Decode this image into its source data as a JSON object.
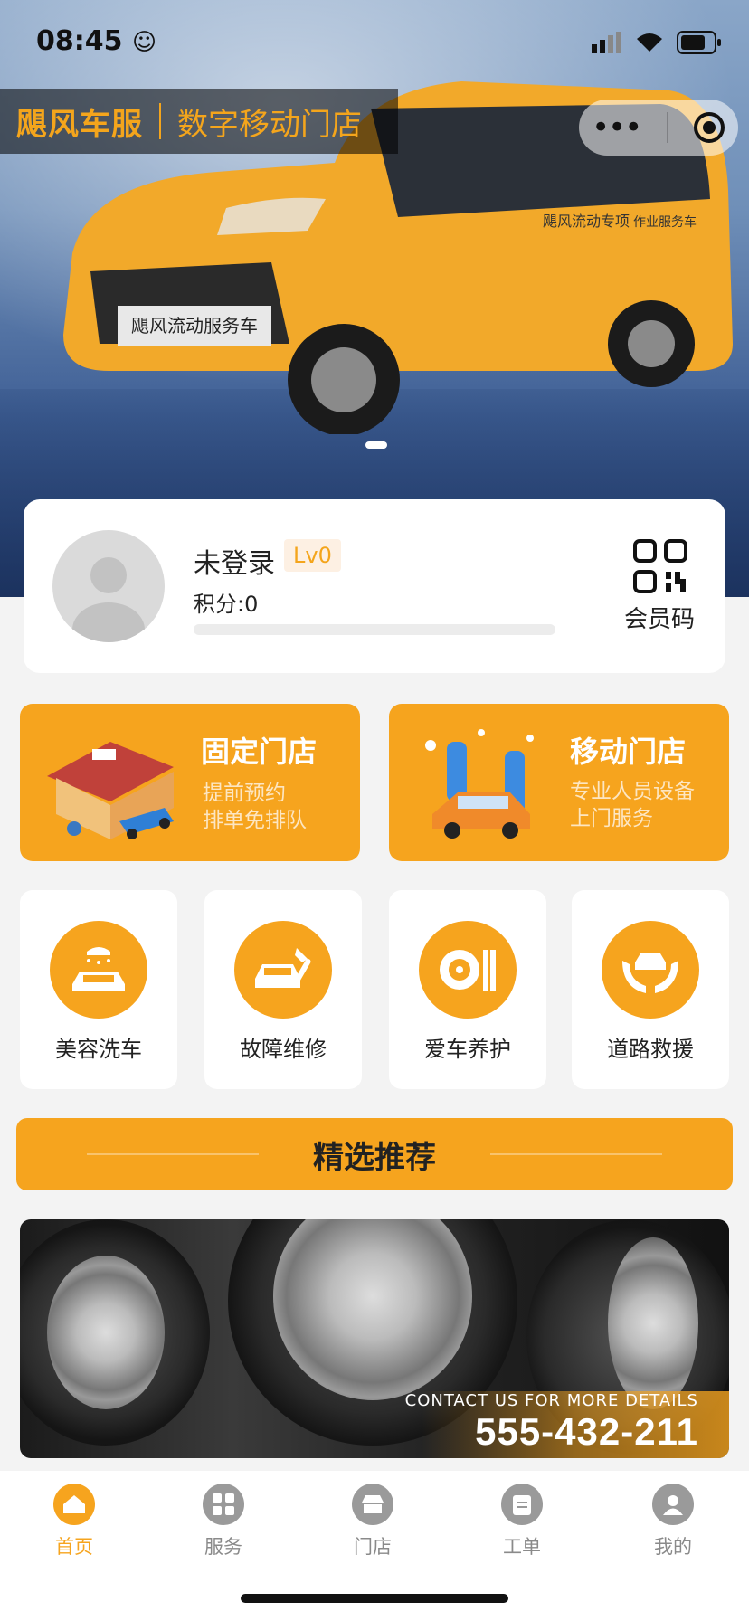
{
  "status_bar": {
    "time": "08:45"
  },
  "hero": {
    "brand_main": "飓风车服",
    "brand_sub": "数字移动门店"
  },
  "member": {
    "name": "未登录",
    "level": "Lv0",
    "points": "积分:0",
    "progress": 0,
    "qr_label": "会员码"
  },
  "stores": [
    {
      "title": "固定门店",
      "desc_line1": "提前预约",
      "desc_line2": "排单免排队"
    },
    {
      "title": "移动门店",
      "desc_line1": "专业人员设备",
      "desc_line2": "上门服务"
    }
  ],
  "services": [
    {
      "label": "美容洗车",
      "icon": "car-wash-icon"
    },
    {
      "label": "故障维修",
      "icon": "car-repair-icon"
    },
    {
      "label": "爱车养护",
      "icon": "car-care-icon"
    },
    {
      "label": "道路救援",
      "icon": "road-rescue-icon"
    }
  ],
  "recommend": {
    "title": "精选推荐"
  },
  "banner": {
    "contact_text": "CONTACT US FOR MORE DETAILS",
    "phone": "555-432-211"
  },
  "tabs": [
    {
      "label": "首页",
      "icon": "home-icon",
      "active": true
    },
    {
      "label": "服务",
      "icon": "grid-icon",
      "active": false
    },
    {
      "label": "门店",
      "icon": "store-icon",
      "active": false
    },
    {
      "label": "工单",
      "icon": "clipboard-icon",
      "active": false
    },
    {
      "label": "我的",
      "icon": "user-icon",
      "active": false
    }
  ],
  "colors": {
    "accent": "#f6a41e",
    "background": "#f3f3f3"
  }
}
